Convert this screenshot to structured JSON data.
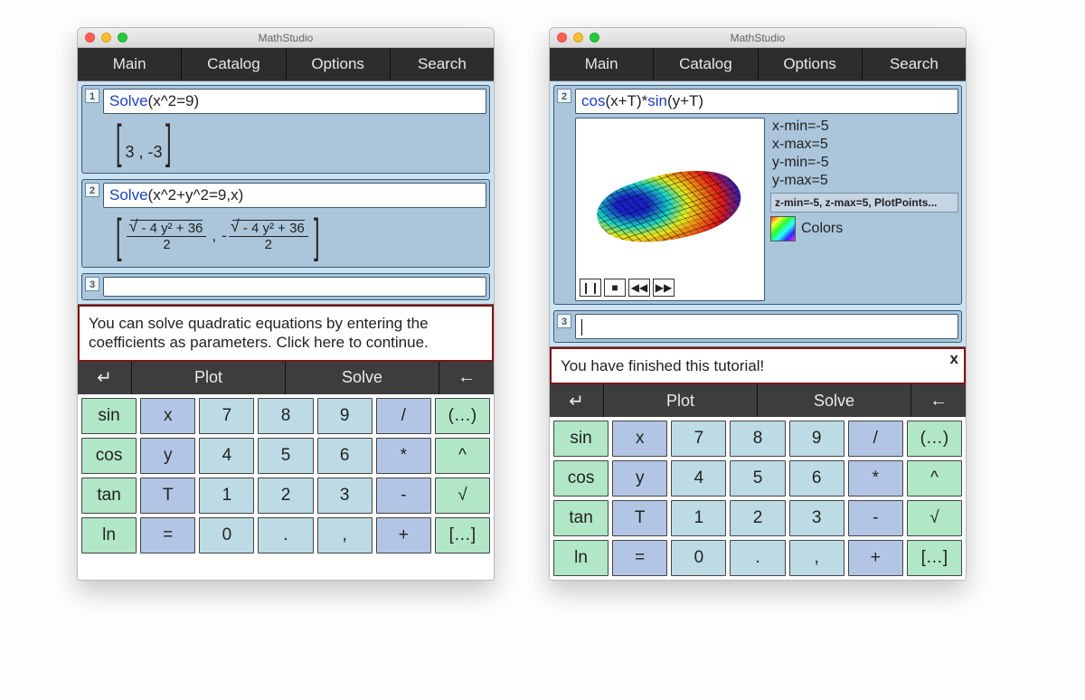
{
  "app_title": "MathStudio",
  "tabs": [
    "Main",
    "Catalog",
    "Options",
    "Search"
  ],
  "actionbar": {
    "enter": "↵",
    "plot": "Plot",
    "solve": "Solve",
    "back": "←"
  },
  "keypad": [
    [
      {
        "t": "sin",
        "c": "green"
      },
      {
        "t": "x",
        "c": "blue"
      },
      {
        "t": "7",
        "c": "lblue"
      },
      {
        "t": "8",
        "c": "lblue"
      },
      {
        "t": "9",
        "c": "lblue"
      },
      {
        "t": "/",
        "c": "blue"
      },
      {
        "t": "(…)",
        "c": "green"
      }
    ],
    [
      {
        "t": "cos",
        "c": "green"
      },
      {
        "t": "y",
        "c": "blue"
      },
      {
        "t": "4",
        "c": "lblue"
      },
      {
        "t": "5",
        "c": "lblue"
      },
      {
        "t": "6",
        "c": "lblue"
      },
      {
        "t": "*",
        "c": "blue"
      },
      {
        "t": "^",
        "c": "green"
      }
    ],
    [
      {
        "t": "tan",
        "c": "green"
      },
      {
        "t": "T",
        "c": "blue"
      },
      {
        "t": "1",
        "c": "lblue"
      },
      {
        "t": "2",
        "c": "lblue"
      },
      {
        "t": "3",
        "c": "lblue"
      },
      {
        "t": "-",
        "c": "blue"
      },
      {
        "t": "√",
        "c": "green"
      }
    ],
    [
      {
        "t": "ln",
        "c": "green"
      },
      {
        "t": "=",
        "c": "blue"
      },
      {
        "t": "0",
        "c": "lblue"
      },
      {
        "t": ".",
        "c": "lblue"
      },
      {
        "t": ",",
        "c": "lblue"
      },
      {
        "t": "+",
        "c": "blue"
      },
      {
        "t": "[…]",
        "c": "green"
      }
    ]
  ],
  "left": {
    "cells": [
      {
        "num": "1",
        "fn": "Solve",
        "args": "(x^2=9)",
        "out_plain": "[3, -3]"
      },
      {
        "num": "2",
        "fn": "Solve",
        "args": "(x^2+y^2=9,x)"
      },
      {
        "num": "3"
      }
    ],
    "frac1_num": "- 4 y² + 36",
    "frac1_den": "2",
    "frac2_num": "- 4 y² + 36",
    "frac2_den": "2",
    "comma": ",",
    "neg": "-",
    "tutorial": "You can solve quadratic equations by entering the coefficients as parameters.  Click here to continue."
  },
  "right": {
    "cells": [
      {
        "num": "2",
        "expr_pre": "cos",
        "expr_mid": "(x+T)*",
        "expr_fn2": "sin",
        "expr_post": "(y+T)"
      },
      {
        "num": "3"
      }
    ],
    "params": {
      "xmin": "x-min=-5",
      "xmax": "x-max=5",
      "ymin": "y-min=-5",
      "ymax": "y-max=5",
      "extra": "z-min=-5, z-max=5, PlotPoints...",
      "colors": "Colors"
    },
    "controls": {
      "pause": "❙❙",
      "stop": "■",
      "rew": "◀◀",
      "fwd": "▶▶"
    },
    "tutorial": "You have finished this tutorial!",
    "close": "x"
  }
}
